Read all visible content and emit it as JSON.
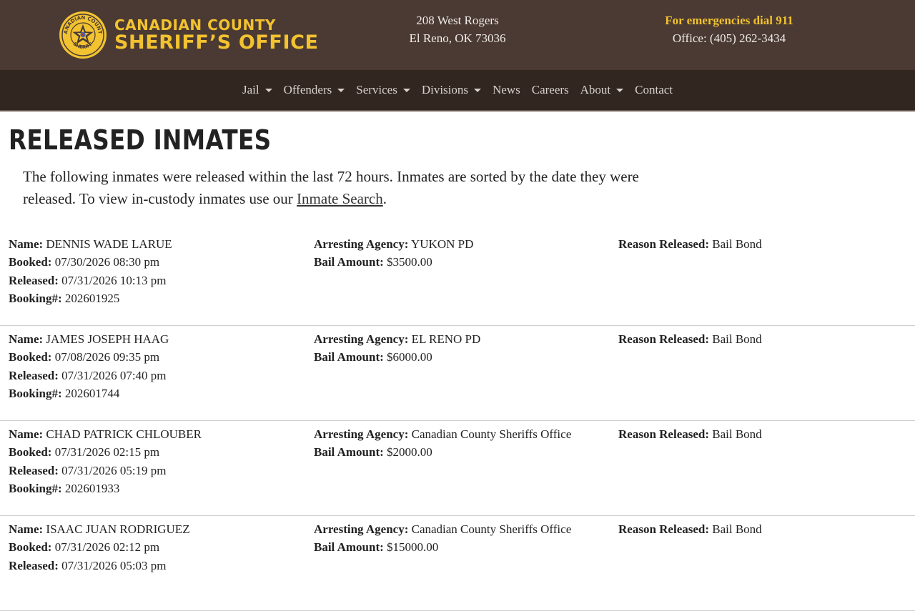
{
  "header": {
    "logo_line1": "CANADIAN COUNTY",
    "logo_line2": "SHERIFF’S OFFICE",
    "seal_top_text": "CANADIAN COUNTY",
    "seal_bottom_text": "SHERIFF",
    "address_line1": "208 West Rogers",
    "address_line2": "El Reno, OK 73036",
    "emergency": "For emergencies dial 911",
    "office_phone": "Office: (405) 262-3434",
    "colors": {
      "header_bg": "#4a3a33",
      "nav_bg": "#322621",
      "accent": "#f2c230"
    }
  },
  "nav": {
    "items": [
      {
        "label": "Jail",
        "dropdown": true
      },
      {
        "label": "Offenders",
        "dropdown": true
      },
      {
        "label": "Services",
        "dropdown": true
      },
      {
        "label": "Divisions",
        "dropdown": true
      },
      {
        "label": "News",
        "dropdown": false
      },
      {
        "label": "Careers",
        "dropdown": false
      },
      {
        "label": "About",
        "dropdown": true
      },
      {
        "label": "Contact",
        "dropdown": false
      }
    ]
  },
  "page": {
    "title": "RELEASED INMATES",
    "intro_text": "The following inmates were released within the last 72 hours. Inmates are sorted by the date they were released. To view in-custody inmates use our ",
    "intro_link": "Inmate Search",
    "intro_end": "."
  },
  "labels": {
    "name": "Name:",
    "booked": "Booked:",
    "released": "Released:",
    "booking": "Booking#:",
    "agency": "Arresting Agency:",
    "bail": "Bail Amount:",
    "reason": "Reason Released:"
  },
  "inmates": [
    {
      "name": "DENNIS WADE LARUE",
      "booked": "07/30/2026 08:30 pm",
      "released": "07/31/2026 10:13 pm",
      "booking": "202601925",
      "agency": "YUKON PD",
      "bail": "$3500.00",
      "reason": "Bail Bond"
    },
    {
      "name": "JAMES JOSEPH HAAG",
      "booked": "07/08/2026 09:35 pm",
      "released": "07/31/2026 07:40 pm",
      "booking": "202601744",
      "agency": "EL RENO PD",
      "bail": "$6000.00",
      "reason": "Bail Bond"
    },
    {
      "name": "CHAD PATRICK CHLOUBER",
      "booked": "07/31/2026 02:15 pm",
      "released": "07/31/2026 05:19 pm",
      "booking": "202601933",
      "agency": "Canadian County Sheriffs Office",
      "bail": "$2000.00",
      "reason": "Bail Bond"
    },
    {
      "name": "ISAAC JUAN RODRIGUEZ",
      "booked": "07/31/2026 02:12 pm",
      "released": "07/31/2026 05:03 pm",
      "booking": "",
      "agency": "Canadian County Sheriffs Office",
      "bail": "$15000.00",
      "reason": "Bail Bond"
    }
  ]
}
